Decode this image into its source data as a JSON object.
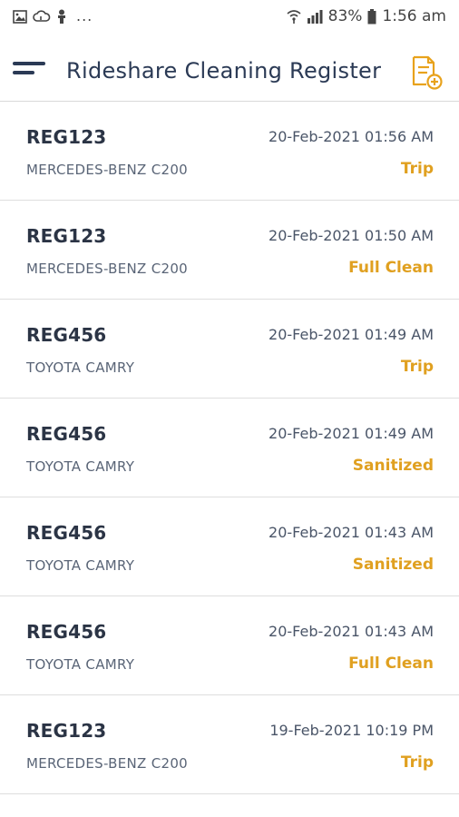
{
  "status_bar": {
    "dots": "...",
    "battery": "83%",
    "time": "1:56 am"
  },
  "app_bar": {
    "title": "Rideshare Cleaning Register",
    "accent_color": "#e8a21c"
  },
  "entries": [
    {
      "reg": "REG123",
      "datetime": "20-Feb-2021 01:56 AM",
      "vehicle": "MERCEDES-BENZ C200",
      "type": "Trip"
    },
    {
      "reg": "REG123",
      "datetime": "20-Feb-2021 01:50 AM",
      "vehicle": "MERCEDES-BENZ C200",
      "type": "Full Clean"
    },
    {
      "reg": "REG456",
      "datetime": "20-Feb-2021 01:49 AM",
      "vehicle": "TOYOTA CAMRY",
      "type": "Trip"
    },
    {
      "reg": "REG456",
      "datetime": "20-Feb-2021 01:49 AM",
      "vehicle": "TOYOTA CAMRY",
      "type": "Sanitized"
    },
    {
      "reg": "REG456",
      "datetime": "20-Feb-2021 01:43 AM",
      "vehicle": "TOYOTA CAMRY",
      "type": "Sanitized"
    },
    {
      "reg": "REG456",
      "datetime": "20-Feb-2021 01:43 AM",
      "vehicle": "TOYOTA CAMRY",
      "type": "Full Clean"
    },
    {
      "reg": "REG123",
      "datetime": "19-Feb-2021 10:19 PM",
      "vehicle": "MERCEDES-BENZ C200",
      "type": "Trip"
    }
  ]
}
